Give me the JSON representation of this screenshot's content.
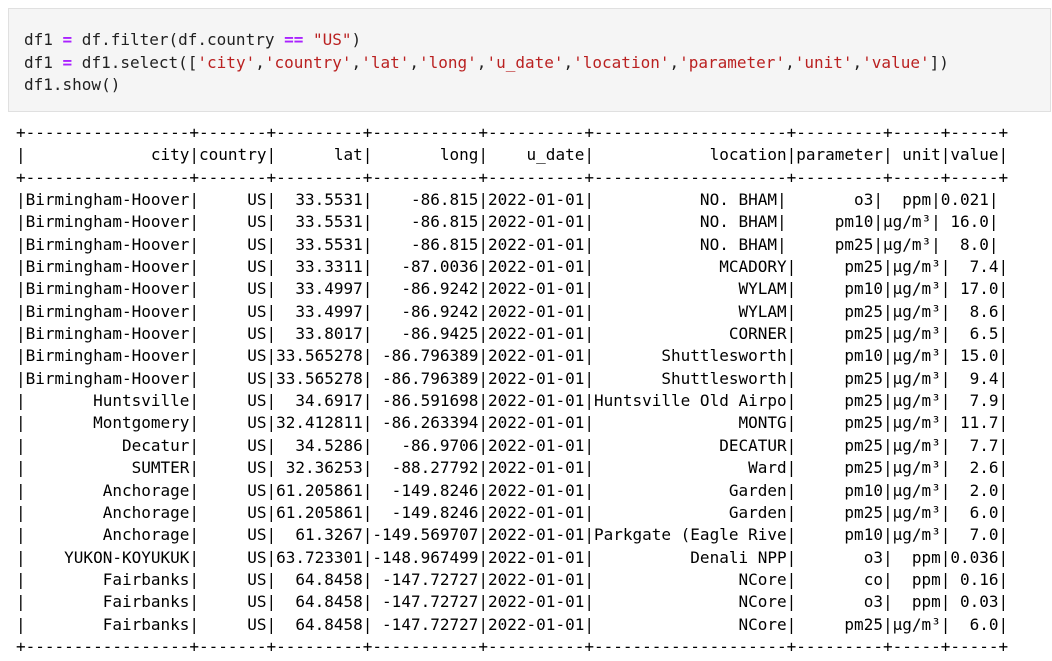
{
  "code_cell": {
    "line1": {
      "a": "df1 ",
      "op1": "=",
      "b": " df.filter(df.country ",
      "op2": "==",
      "c": " ",
      "s": "\"US\"",
      "d": ")"
    },
    "line2": {
      "a": "df1 ",
      "op1": "=",
      "b": " df1.select([",
      "s1": "'city'",
      "s2": "'country'",
      "s3": "'lat'",
      "s4": "'long'",
      "s5": "'u_date'",
      "s6": "'location'",
      "s7": "'parameter'",
      "s8": "'unit'",
      "s9": "'value'",
      "comma": ",",
      "end": "])"
    },
    "line3": "df1.show()"
  },
  "output": {
    "border": "+-----------------+-------+---------+-----------+----------+--------------------+---------+-----+-----+",
    "header": "|             city|country|      lat|       long|    u_date|            location|parameter| unit|value|",
    "rows": [
      "|Birmingham-Hoover|     US|  33.5531|    -86.815|2022-01-01|           NO. BHAM|       o3|  ppm|0.021|",
      "|Birmingham-Hoover|     US|  33.5531|    -86.815|2022-01-01|           NO. BHAM|     pm10|µg/m³| 16.0|",
      "|Birmingham-Hoover|     US|  33.5531|    -86.815|2022-01-01|           NO. BHAM|     pm25|µg/m³|  8.0|",
      "|Birmingham-Hoover|     US|  33.3311|   -87.0036|2022-01-01|             MCADORY|     pm25|µg/m³|  7.4|",
      "|Birmingham-Hoover|     US|  33.4997|   -86.9242|2022-01-01|               WYLAM|     pm10|µg/m³| 17.0|",
      "|Birmingham-Hoover|     US|  33.4997|   -86.9242|2022-01-01|               WYLAM|     pm25|µg/m³|  8.6|",
      "|Birmingham-Hoover|     US|  33.8017|   -86.9425|2022-01-01|              CORNER|     pm25|µg/m³|  6.5|",
      "|Birmingham-Hoover|     US|33.565278| -86.796389|2022-01-01|       Shuttlesworth|     pm10|µg/m³| 15.0|",
      "|Birmingham-Hoover|     US|33.565278| -86.796389|2022-01-01|       Shuttlesworth|     pm25|µg/m³|  9.4|",
      "|       Huntsville|     US|  34.6917| -86.591698|2022-01-01|Huntsville Old Airpo|     pm25|µg/m³|  7.9|",
      "|       Montgomery|     US|32.412811| -86.263394|2022-01-01|               MONTG|     pm25|µg/m³| 11.7|",
      "|          Decatur|     US|  34.5286|   -86.9706|2022-01-01|             DECATUR|     pm25|µg/m³|  7.7|",
      "|           SUMTER|     US| 32.36253|  -88.27792|2022-01-01|                Ward|     pm25|µg/m³|  2.6|",
      "|        Anchorage|     US|61.205861|  -149.8246|2022-01-01|              Garden|     pm10|µg/m³|  2.0|",
      "|        Anchorage|     US|61.205861|  -149.8246|2022-01-01|              Garden|     pm25|µg/m³|  6.0|",
      "|        Anchorage|     US|  61.3267|-149.569707|2022-01-01|Parkgate (Eagle Rive|     pm10|µg/m³|  7.0|",
      "|    YUKON-KOYUKUK|     US|63.723301|-148.967499|2022-01-01|          Denali NPP|       o3|  ppm|0.036|",
      "|        Fairbanks|     US|  64.8458| -147.72727|2022-01-01|               NCore|       co|  ppm| 0.16|",
      "|        Fairbanks|     US|  64.8458| -147.72727|2022-01-01|               NCore|       o3|  ppm| 0.03|",
      "|        Fairbanks|     US|  64.8458| -147.72727|2022-01-01|               NCore|     pm25|µg/m³|  6.0|"
    ]
  },
  "colors": {
    "cell_background": "#f5f5f5",
    "cell_border": "#e0e0e0",
    "keyword_operator": "#aa22ff",
    "string_literal": "#ba2121"
  }
}
